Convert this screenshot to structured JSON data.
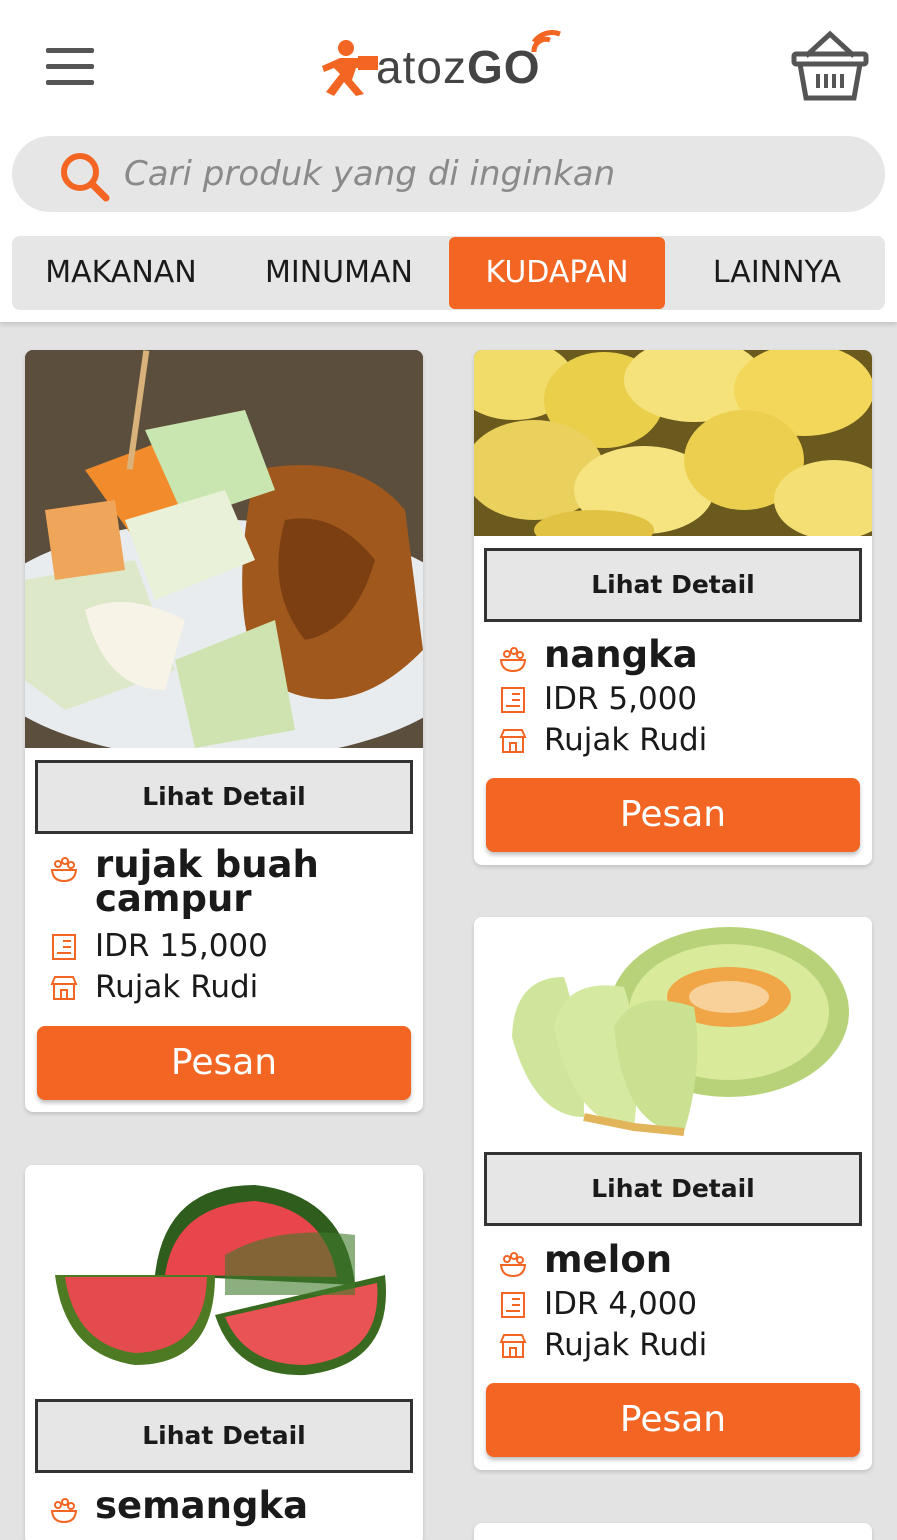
{
  "header": {
    "logo_text_prefix": "atoz",
    "logo_text_suffix": "GO",
    "menu_icon": "hamburger-menu-icon",
    "cart_icon": "basket-icon"
  },
  "search": {
    "placeholder": "Cari produk yang di inginkan",
    "icon": "search-icon"
  },
  "tabs": [
    {
      "label": "MAKANAN",
      "active": false
    },
    {
      "label": "MINUMAN",
      "active": false
    },
    {
      "label": "KUDAPAN",
      "active": true
    },
    {
      "label": "LAINNYA",
      "active": false
    }
  ],
  "colors": {
    "accent": "#f26522",
    "background": "#e3e3e3"
  },
  "products": [
    {
      "name": "rujak buah campur",
      "price": "IDR 15,000",
      "store": "Rujak Rudi",
      "detail_label": "Lihat Detail",
      "order_label": "Pesan"
    },
    {
      "name": "nangka",
      "price": "IDR 5,000",
      "store": "Rujak Rudi",
      "detail_label": "Lihat Detail",
      "order_label": "Pesan"
    },
    {
      "name": "melon",
      "price": "IDR 4,000",
      "store": "Rujak Rudi",
      "detail_label": "Lihat Detail",
      "order_label": "Pesan"
    },
    {
      "name": "semangka",
      "detail_label": "Lihat Detail"
    }
  ]
}
